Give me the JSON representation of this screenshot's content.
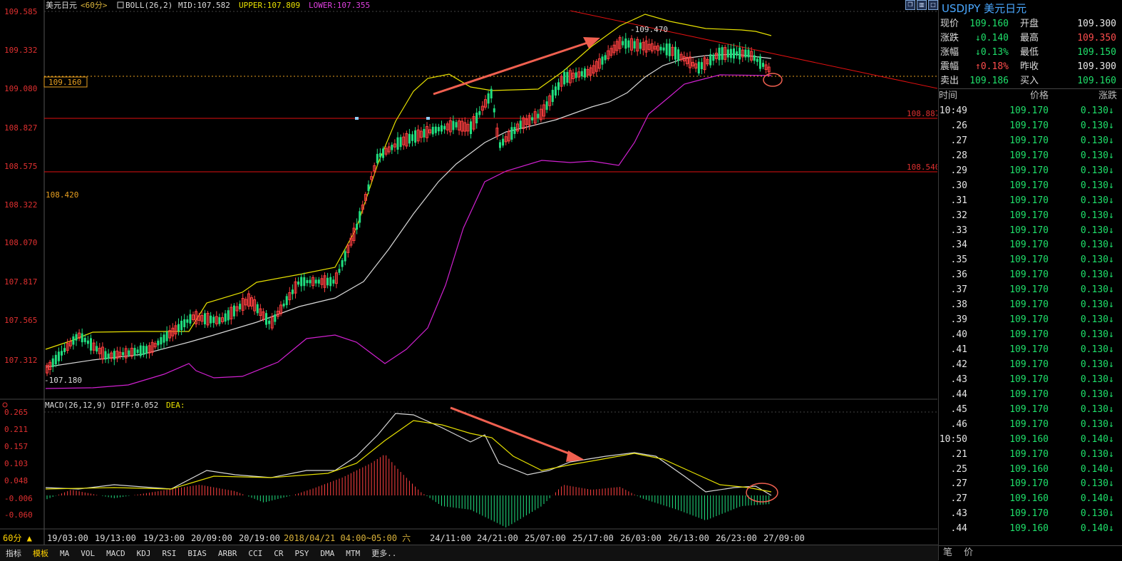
{
  "header": {
    "symbol_name": "美元日元",
    "period": "<60分>",
    "indicator": "BOLL(26,2)",
    "mid": "MID:107.582",
    "upper": "UPPER:107.809",
    "lower": "LOWER:107.355"
  },
  "macd_header": {
    "label": "MACD(26,12,9)",
    "diff": "DIFF:0.052",
    "dea": "DEA:"
  },
  "price_axis": [
    "109.585",
    "109.332",
    "109.080",
    "108.827",
    "108.575",
    "108.322",
    "108.070",
    "107.817",
    "107.565",
    "107.312"
  ],
  "macd_axis": [
    "0.265",
    "0.211",
    "0.157",
    "0.103",
    "0.048",
    "-0.006",
    "-0.060"
  ],
  "time_axis": [
    "19/03:00",
    "19/13:00",
    "19/23:00",
    "20/09:00",
    "20/19:00",
    "2018/04/21 04:00~05:00 六",
    "24/11:00",
    "24/21:00",
    "25/07:00",
    "25/17:00",
    "26/03:00",
    "26/13:00",
    "26/23:00",
    "27/09:00"
  ],
  "labels": {
    "current_price_box": "109.160",
    "left_mark": "108.420",
    "high_mark": "109.470",
    "low_mark": "107.180",
    "hline_top": "108.887",
    "hline_bottom": "108.540"
  },
  "period_button": "60分 ▲",
  "bottom_tabs": [
    "指标",
    "模板",
    "MA",
    "VOL",
    "MACD",
    "KDJ",
    "RSI",
    "BIAS",
    "ARBR",
    "CCI",
    "CR",
    "PSY",
    "DMA",
    "MTM",
    "更多.."
  ],
  "quote_panel": {
    "title": "USDJPY 美元日元",
    "rows": [
      {
        "k1": "现价",
        "v1": "109.160",
        "v1c": "g",
        "k2": "开盘",
        "v2": "109.300",
        "v2c": "w"
      },
      {
        "k1": "涨跌",
        "v1": "↓0.140",
        "v1c": "g",
        "k2": "最高",
        "v2": "109.350",
        "v2c": "r"
      },
      {
        "k1": "涨幅",
        "v1": "↓0.13%",
        "v1c": "g",
        "k2": "最低",
        "v2": "109.150",
        "v2c": "g"
      },
      {
        "k1": "震幅",
        "v1": "↑0.18%",
        "v1c": "r",
        "k2": "昨收",
        "v2": "109.300",
        "v2c": "w"
      },
      {
        "k1": "卖出",
        "v1": "109.186",
        "v1c": "g",
        "k2": "买入",
        "v2": "109.160",
        "v2c": "g"
      }
    ],
    "tick_headers": [
      "时间",
      "价格",
      "涨跌"
    ],
    "ticks": [
      [
        "10:49",
        "109.170",
        "0.130"
      ],
      [
        ".26",
        "109.170",
        "0.130"
      ],
      [
        ".27",
        "109.170",
        "0.130"
      ],
      [
        ".28",
        "109.170",
        "0.130"
      ],
      [
        ".29",
        "109.170",
        "0.130"
      ],
      [
        ".30",
        "109.170",
        "0.130"
      ],
      [
        ".31",
        "109.170",
        "0.130"
      ],
      [
        ".32",
        "109.170",
        "0.130"
      ],
      [
        ".33",
        "109.170",
        "0.130"
      ],
      [
        ".34",
        "109.170",
        "0.130"
      ],
      [
        ".35",
        "109.170",
        "0.130"
      ],
      [
        ".36",
        "109.170",
        "0.130"
      ],
      [
        ".37",
        "109.170",
        "0.130"
      ],
      [
        ".38",
        "109.170",
        "0.130"
      ],
      [
        ".39",
        "109.170",
        "0.130"
      ],
      [
        ".40",
        "109.170",
        "0.130"
      ],
      [
        ".41",
        "109.170",
        "0.130"
      ],
      [
        ".42",
        "109.170",
        "0.130"
      ],
      [
        ".43",
        "109.170",
        "0.130"
      ],
      [
        ".44",
        "109.170",
        "0.130"
      ],
      [
        ".45",
        "109.170",
        "0.130"
      ],
      [
        ".46",
        "109.170",
        "0.130"
      ],
      [
        "10:50",
        "109.160",
        "0.140"
      ],
      [
        ".21",
        "109.170",
        "0.130"
      ],
      [
        ".25",
        "109.160",
        "0.140"
      ],
      [
        ".27",
        "109.170",
        "0.130"
      ],
      [
        ".27",
        "109.160",
        "0.140"
      ],
      [
        ".43",
        "109.170",
        "0.130"
      ],
      [
        ".44",
        "109.160",
        "0.140"
      ]
    ],
    "footer": [
      "笔",
      "价"
    ]
  },
  "chart_data": {
    "type": "candlestick",
    "price_range": [
      107.18,
      109.585
    ],
    "macd_range": [
      -0.12,
      0.265
    ],
    "horizontal_lines": [
      108.887,
      108.54
    ],
    "current_price": 109.16,
    "key_points": {
      "high": 109.47,
      "low": 107.18
    }
  }
}
